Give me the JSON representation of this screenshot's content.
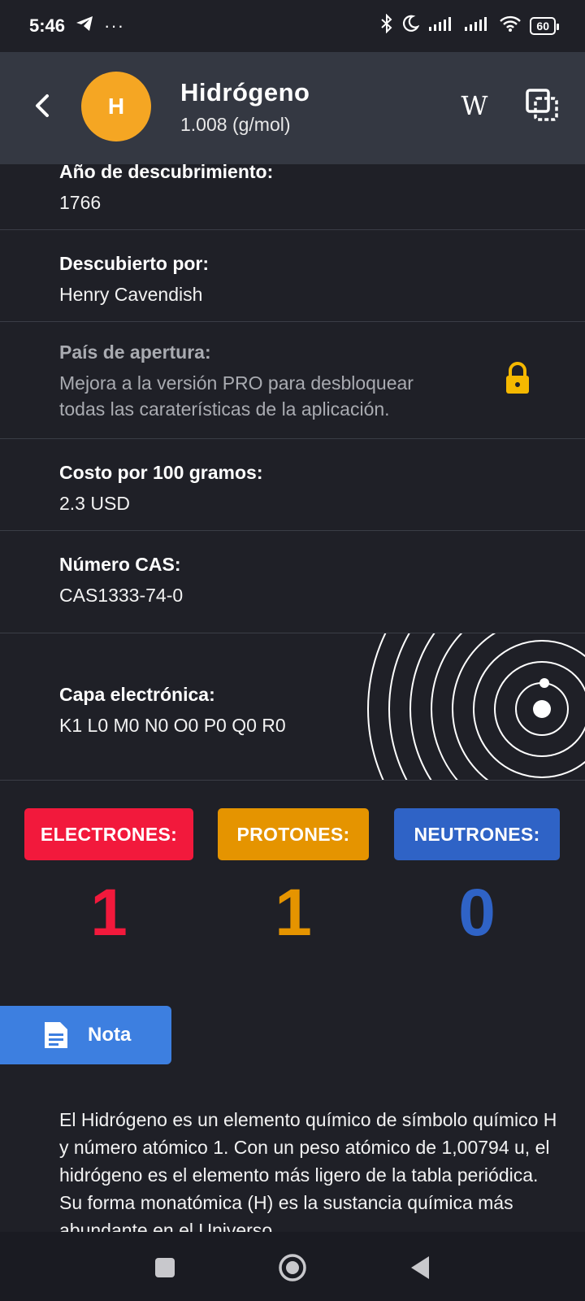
{
  "status": {
    "time": "5:46",
    "battery": "60"
  },
  "header": {
    "symbol": "H",
    "title": "Hidrógeno",
    "subtitle": "1.008 (g/mol)",
    "wiki_label": "W"
  },
  "info": [
    {
      "label": "Año de descubrimiento:",
      "value": "1766"
    },
    {
      "label": "Descubierto por:",
      "value": "Henry Cavendish"
    },
    {
      "label": "País de apertura:",
      "value": "Mejora a la versión PRO para desbloquear todas las caraterísticas de la aplicación.",
      "locked": true
    },
    {
      "label": "Costo por 100 gramos:",
      "value": "2.3 USD"
    },
    {
      "label": "Número CAS:",
      "value": "CAS1333-74-0"
    }
  ],
  "shell": {
    "label": "Capa electrónica:",
    "value": "K1 L0 M0 N0 O0 P0 Q0 R0"
  },
  "counters": [
    {
      "label": "ELECTRONES:",
      "value": "1",
      "color": "#f2193c"
    },
    {
      "label": "PROTONES:",
      "value": "1",
      "color": "#e59400"
    },
    {
      "label": "NEUTRONES:",
      "value": "0",
      "color": "#2f63c6"
    }
  ],
  "note": {
    "button_label": "Nota",
    "text": "El Hidrógeno es un elemento químico de símbolo químico H y número atómico 1. Con un peso atómico de 1,00794 u, el hidrógeno es el elemento más ligero de la tabla periódica. Su forma monatómica (H) es la sustancia química más abundante en el Universo"
  },
  "colors": {
    "accent": "#f5a623",
    "background": "#1f2027",
    "header": "#343842",
    "note_button": "#3d7fe0"
  }
}
